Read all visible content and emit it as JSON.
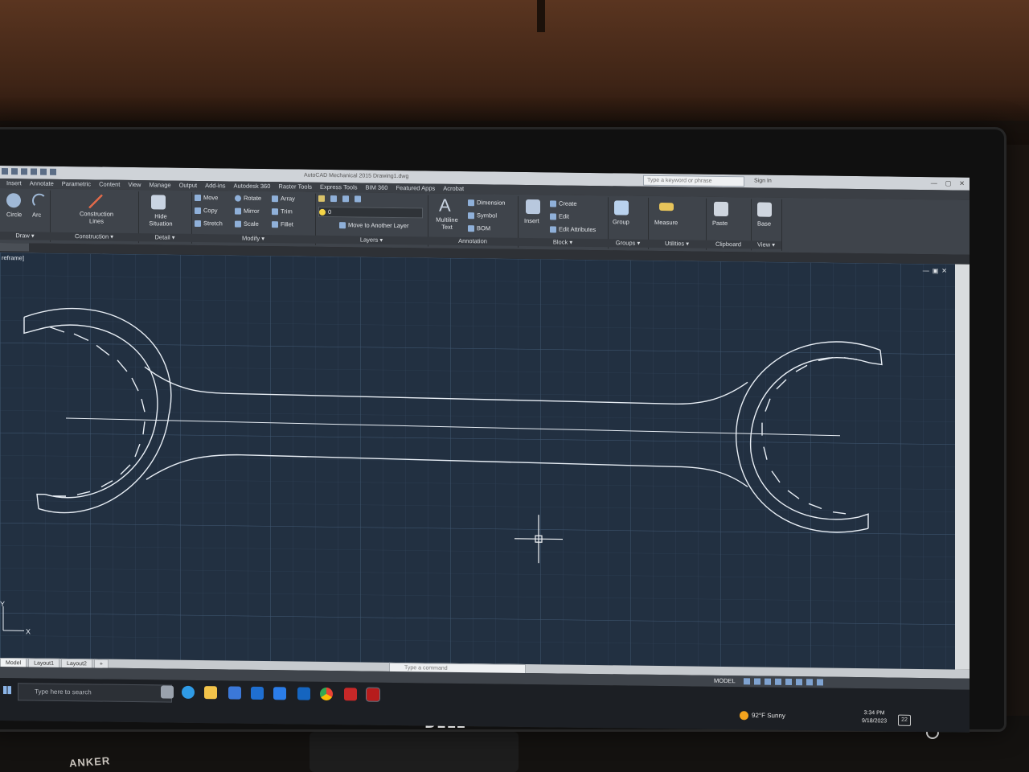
{
  "environment": {
    "monitor_brand": "DELL",
    "desk_item": "ANKER"
  },
  "app": {
    "title": "AutoCAD Mechanical 2015   Drawing1.dwg",
    "search_placeholder": "Type a keyword or phrase",
    "signin_label": "Sign In"
  },
  "menu_tabs": [
    "Insert",
    "Annotate",
    "Parametric",
    "Content",
    "View",
    "Manage",
    "Output",
    "Add-ins",
    "Autodesk 360",
    "Raster Tools",
    "Express Tools",
    "BIM 360",
    "Featured Apps",
    "Acrobat"
  ],
  "ribbon": {
    "draw": {
      "circle": "Circle",
      "arc": "Arc",
      "label": "Draw ▾"
    },
    "construction": {
      "lines": "Construction Lines",
      "label": "Construction ▾"
    },
    "detail": {
      "hide": "Hide Situation",
      "label": "Detail ▾"
    },
    "modify": {
      "move": "Move",
      "rotate": "Rotate",
      "array": "Array",
      "copy": "Copy",
      "mirror": "Mirror",
      "trim": "Trim",
      "stretch": "Stretch",
      "scale": "Scale",
      "fillet": "Fillet",
      "label": "Modify ▾"
    },
    "layers": {
      "layer_value": "0",
      "move_to": "Move to Another Layer",
      "label": "Layers ▾"
    },
    "annotation": {
      "mtext": "Multiline Text",
      "dimension": "Dimension",
      "symbol": "Symbol",
      "bom": "BOM",
      "label": "Annotation"
    },
    "block": {
      "insert": "Insert",
      "create": "Create",
      "edit": "Edit",
      "edit_attr": "Edit Attributes",
      "label": "Block ▾"
    },
    "groups": {
      "group": "Group",
      "label": "Groups ▾"
    },
    "utilities": {
      "measure": "Measure",
      "label": "Utilities ▾"
    },
    "clipboard": {
      "paste": "Paste",
      "label": "Clipboard"
    },
    "view": {
      "base": "Base",
      "label": "View ▾"
    }
  },
  "viewport": {
    "label": "reframe]",
    "axis_y": "Y",
    "axis_x": "X"
  },
  "layout_tabs": [
    "Model",
    "Layout1",
    "Layout2",
    "+"
  ],
  "command_placeholder": "Type a command",
  "statusbar": {
    "model": "MODEL"
  },
  "taskbar": {
    "search_placeholder": "Type here to search",
    "weather": "92°F  Sunny",
    "time": "3:34 PM",
    "date": "9/18/2023",
    "notifications": "22"
  }
}
